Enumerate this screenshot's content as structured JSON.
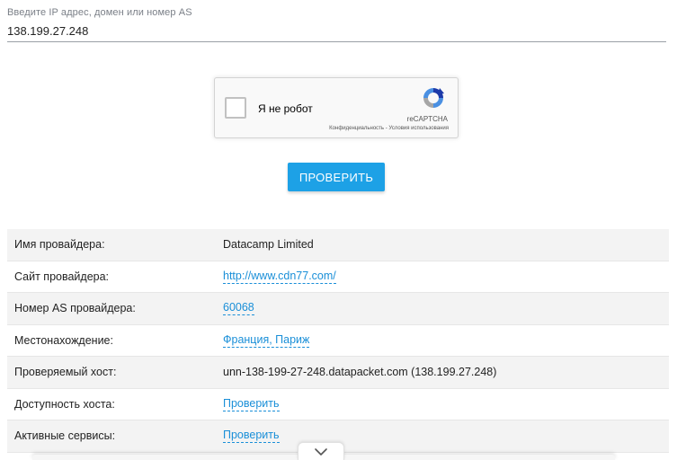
{
  "lookup": {
    "label": "Введите IP адрес, домен или номер AS",
    "value": "138.199.27.248"
  },
  "recaptcha": {
    "label": "Я не робот",
    "brand": "reCAPTCHA",
    "privacy": "Конфиденциальность",
    "separator": " - ",
    "terms": "Условия использования"
  },
  "check_button": "ПРОВЕРИТЬ",
  "results": [
    {
      "key": "Имя провайдера:",
      "value": "Datacamp Limited",
      "link": false
    },
    {
      "key": "Сайт провайдера:",
      "value": "http://www.cdn77.com/",
      "link": true
    },
    {
      "key": "Номер AS провайдера:",
      "value": "60068",
      "link": true
    },
    {
      "key": "Местонахождение:",
      "value": "Франция, Париж",
      "link": true
    },
    {
      "key": "Проверяемый хост:",
      "value": "unn-138-199-27-248.datapacket.com (138.199.27.248)",
      "link": false
    },
    {
      "key": "Доступность хоста:",
      "value": "Проверить",
      "link": true
    },
    {
      "key": "Активные сервисы:",
      "value": "Проверить",
      "link": true
    }
  ],
  "icons": {
    "expand": "chevron-down-icon",
    "recaptcha_logo": "recaptcha-logo-icon"
  },
  "colors": {
    "accent": "#1da1e6",
    "link": "#1a8fd8"
  }
}
